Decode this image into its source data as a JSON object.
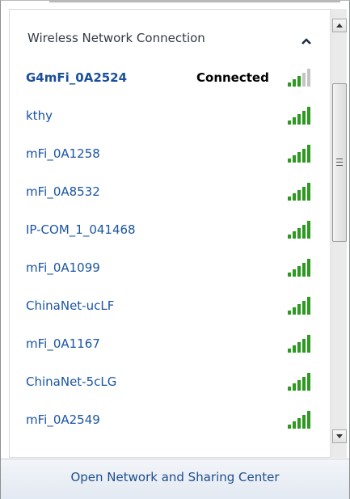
{
  "panel": {
    "section_title": "Wireless Network Connection"
  },
  "networks": [
    {
      "name": "G4mFi_0A2524",
      "status": "Connected",
      "signal_bars": 3,
      "signal_max": 5
    },
    {
      "name": "kthy",
      "status": "",
      "signal_bars": 5,
      "signal_max": 5
    },
    {
      "name": "mFi_0A1258",
      "status": "",
      "signal_bars": 5,
      "signal_max": 5
    },
    {
      "name": "mFi_0A8532",
      "status": "",
      "signal_bars": 5,
      "signal_max": 5
    },
    {
      "name": "IP-COM_1_041468",
      "status": "",
      "signal_bars": 5,
      "signal_max": 5
    },
    {
      "name": "mFi_0A1099",
      "status": "",
      "signal_bars": 5,
      "signal_max": 5
    },
    {
      "name": "ChinaNet-ucLF",
      "status": "",
      "signal_bars": 5,
      "signal_max": 5
    },
    {
      "name": "mFi_0A1167",
      "status": "",
      "signal_bars": 5,
      "signal_max": 5
    },
    {
      "name": "ChinaNet-5cLG",
      "status": "",
      "signal_bars": 5,
      "signal_max": 5
    },
    {
      "name": "mFi_0A2549",
      "status": "",
      "signal_bars": 5,
      "signal_max": 5
    }
  ],
  "footer": {
    "link_label": "Open Network and Sharing Center"
  },
  "icons": {
    "collapse": "chevron-up-icon",
    "signal": "wifi-signal-icon",
    "scroll_up": "arrow-up-icon",
    "scroll_down": "arrow-down-icon"
  },
  "colors": {
    "link": "#1b55a3",
    "signal_active": "#2b9a1f",
    "signal_inactive": "#c4c4c4",
    "footer_bg": "#e9eef5"
  }
}
